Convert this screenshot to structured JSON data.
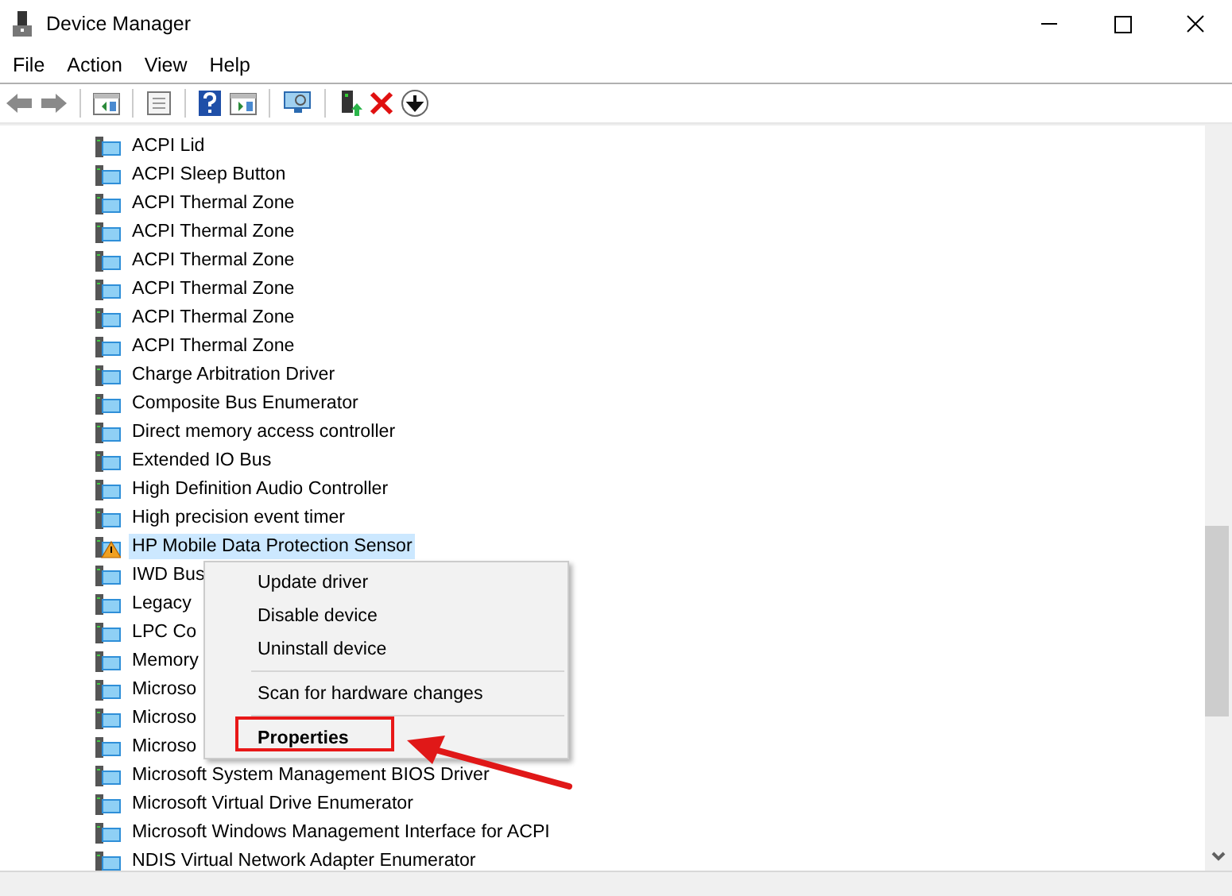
{
  "window": {
    "title": "Device Manager"
  },
  "menu_bar": [
    "File",
    "Action",
    "View",
    "Help"
  ],
  "tree": {
    "rows": [
      {
        "label": "ACPI Lid",
        "kind": "device",
        "selected": false
      },
      {
        "label": "ACPI Sleep Button",
        "kind": "device",
        "selected": false
      },
      {
        "label": "ACPI Thermal Zone",
        "kind": "device",
        "selected": false
      },
      {
        "label": "ACPI Thermal Zone",
        "kind": "device",
        "selected": false
      },
      {
        "label": "ACPI Thermal Zone",
        "kind": "device",
        "selected": false
      },
      {
        "label": "ACPI Thermal Zone",
        "kind": "device",
        "selected": false
      },
      {
        "label": "ACPI Thermal Zone",
        "kind": "device",
        "selected": false
      },
      {
        "label": "ACPI Thermal Zone",
        "kind": "device",
        "selected": false
      },
      {
        "label": "Charge Arbitration Driver",
        "kind": "device",
        "selected": false
      },
      {
        "label": "Composite Bus Enumerator",
        "kind": "device",
        "selected": false
      },
      {
        "label": "Direct memory access controller",
        "kind": "device",
        "selected": false
      },
      {
        "label": "Extended IO Bus",
        "kind": "device",
        "selected": false
      },
      {
        "label": "High Definition Audio Controller",
        "kind": "device",
        "selected": false
      },
      {
        "label": "High precision event timer",
        "kind": "device",
        "selected": false
      },
      {
        "label": "HP Mobile Data Protection Sensor",
        "kind": "warning",
        "selected": true
      },
      {
        "label": "IWD Bus",
        "kind": "device",
        "selected": false
      },
      {
        "label": "Legacy",
        "kind": "device",
        "selected": false
      },
      {
        "label": "LPC Co",
        "kind": "device",
        "selected": false
      },
      {
        "label": "Memory",
        "kind": "device",
        "selected": false
      },
      {
        "label": "Microso",
        "kind": "device",
        "selected": false
      },
      {
        "label": "Microso",
        "kind": "device",
        "selected": false
      },
      {
        "label": "Microso",
        "kind": "device",
        "selected": false
      },
      {
        "label": "Microsoft System Management BIOS Driver",
        "kind": "device",
        "selected": false
      },
      {
        "label": "Microsoft Virtual Drive Enumerator",
        "kind": "device",
        "selected": false
      },
      {
        "label": "Microsoft Windows Management Interface for ACPI",
        "kind": "device",
        "selected": false
      },
      {
        "label": "NDIS Virtual Network Adapter Enumerator",
        "kind": "device",
        "selected": false
      }
    ]
  },
  "context_menu": {
    "items": [
      {
        "kind": "item",
        "label": "Update driver",
        "default": false
      },
      {
        "kind": "item",
        "label": "Disable device",
        "default": false
      },
      {
        "kind": "item",
        "label": "Uninstall device",
        "default": false
      },
      {
        "kind": "separator"
      },
      {
        "kind": "item",
        "label": "Scan for hardware changes",
        "default": false
      },
      {
        "kind": "separator"
      },
      {
        "kind": "item",
        "label": "Properties",
        "default": true,
        "highlighted": true
      }
    ]
  }
}
